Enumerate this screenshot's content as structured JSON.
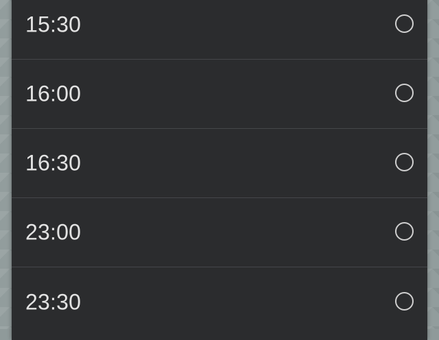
{
  "time_options": [
    {
      "label": "15:30",
      "selected": false
    },
    {
      "label": "16:00",
      "selected": false
    },
    {
      "label": "16:30",
      "selected": false
    },
    {
      "label": "23:00",
      "selected": false
    },
    {
      "label": "23:30",
      "selected": false
    }
  ],
  "colors": {
    "dialog_background": "#2b2c2e",
    "divider": "#45474a",
    "text": "#e3e3e3",
    "radio_outline": "#d0d0d0"
  },
  "icons": {
    "radio_unselected": "radio-unselected-icon"
  }
}
